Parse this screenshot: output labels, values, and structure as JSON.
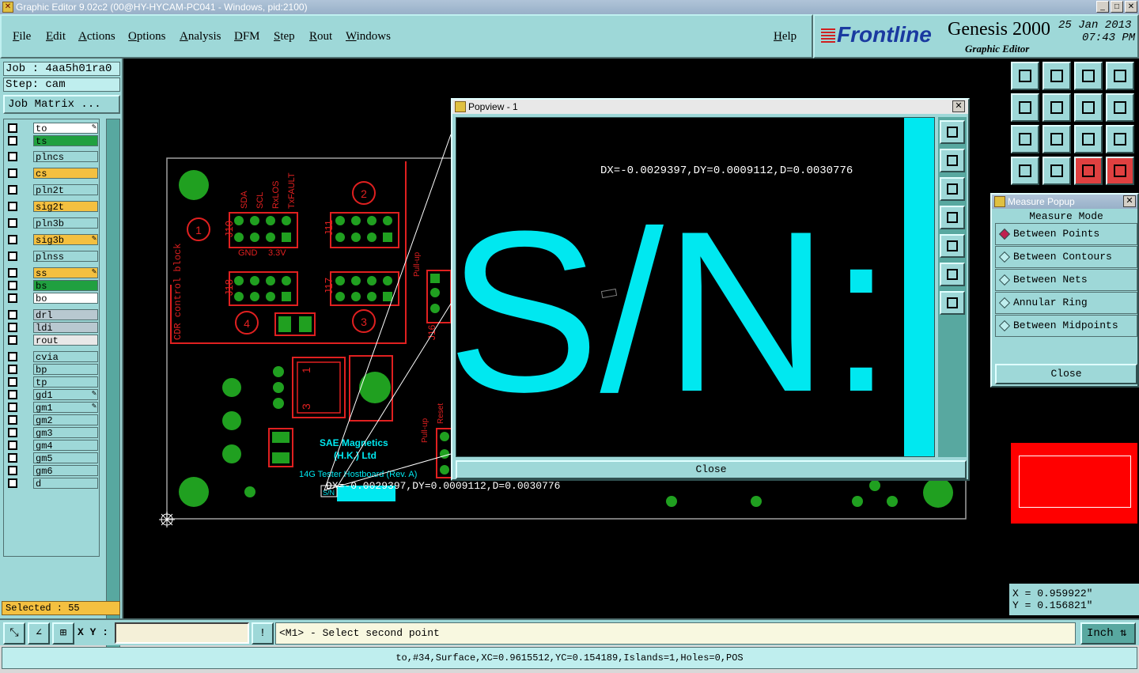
{
  "window": {
    "title": "Graphic Editor 9.02c2 (00@HY-HYCAM-PC041 - Windows, pid:2100)",
    "minimize": "_",
    "maximize": "□",
    "close": "✕"
  },
  "menu": {
    "items": [
      "File",
      "Edit",
      "Actions",
      "Options",
      "Analysis",
      "DFM",
      "Step",
      "Rout",
      "Windows"
    ],
    "help": "Help"
  },
  "brand": {
    "logo": "Frontline",
    "product": "Genesis 2000",
    "subtitle": "Graphic Editor",
    "date": "25 Jan 2013",
    "time": "07:43 PM"
  },
  "job": {
    "job": "Job : 4aa5h01ra0",
    "step": "Step: cam",
    "matrix_button": "Job Matrix ..."
  },
  "layers": [
    {
      "name": "to",
      "color": "#ffffff",
      "flag": "✎"
    },
    {
      "name": "ts",
      "color": "#20a040",
      "flag": ""
    },
    {
      "name": "plncs",
      "color": "#9ed8d8",
      "flag": ""
    },
    {
      "name": "cs",
      "color": "#f4c040",
      "flag": ""
    },
    {
      "name": "pln2t",
      "color": "#9ed8d8",
      "flag": ""
    },
    {
      "name": "sig2t",
      "color": "#f4c040",
      "flag": ""
    },
    {
      "name": "pln3b",
      "color": "#9ed8d8",
      "flag": ""
    },
    {
      "name": "sig3b",
      "color": "#f4c040",
      "flag": "✎"
    },
    {
      "name": "plnss",
      "color": "#9ed8d8",
      "flag": ""
    },
    {
      "name": "ss",
      "color": "#f4c040",
      "flag": "✎"
    },
    {
      "name": "bs",
      "color": "#20a040",
      "flag": ""
    },
    {
      "name": "bo",
      "color": "#ffffff",
      "flag": ""
    },
    {
      "name": "drl",
      "color": "#b8c8d0",
      "flag": ""
    },
    {
      "name": "ldi",
      "color": "#b8c8d0",
      "flag": ""
    },
    {
      "name": "rout",
      "color": "#e8e8e8",
      "flag": ""
    },
    {
      "name": "cvia",
      "color": "#9ed8d8",
      "flag": ""
    },
    {
      "name": "bp",
      "color": "#9ed8d8",
      "flag": ""
    },
    {
      "name": "tp",
      "color": "#9ed8d8",
      "flag": ""
    },
    {
      "name": "gd1",
      "color": "#9ed8d8",
      "flag": "✎"
    },
    {
      "name": "gm1",
      "color": "#9ed8d8",
      "flag": "✎"
    },
    {
      "name": "gm2",
      "color": "#9ed8d8",
      "flag": ""
    },
    {
      "name": "gm3",
      "color": "#9ed8d8",
      "flag": ""
    },
    {
      "name": "gm4",
      "color": "#9ed8d8",
      "flag": ""
    },
    {
      "name": "gm5",
      "color": "#9ed8d8",
      "flag": ""
    },
    {
      "name": "gm6",
      "color": "#9ed8d8",
      "flag": ""
    },
    {
      "name": "d",
      "color": "#9ed8d8",
      "flag": ""
    }
  ],
  "selected": "Selected : 55",
  "board": {
    "connectors": [
      "J10",
      "J11",
      "J18",
      "J17",
      "J16"
    ],
    "pin_labels": [
      "SDA",
      "SCL",
      "RxLOS",
      "TxFAULT"
    ],
    "power_labels": [
      "GND",
      "3.3V"
    ],
    "circle_numbers": [
      "1",
      "2",
      "3",
      "4"
    ],
    "block_label": "CDR control block",
    "pullup_labels": [
      "Pull-up",
      "Pull-up",
      "Reset"
    ],
    "company_line1": "SAE Magnetics",
    "company_line2": "(H.K.) Ltd",
    "board_name": "14G Tester Hostboard (Rev. A)",
    "sn_label": "S/N",
    "measure_readout": "DX=-0.0029397,DY=0.0009112,D=0.0030776",
    "ic_pins": [
      "1",
      "3"
    ]
  },
  "popview": {
    "title": "Popview - 1",
    "readout": "DX=-0.0029397,DY=0.0009112,D=0.0030776",
    "zoom_text": "S/N:",
    "close": "Close"
  },
  "measure": {
    "title": "Measure Popup",
    "mode_header": "Measure Mode",
    "options": [
      "Between Points",
      "Between Contours",
      "Between Nets",
      "Annular Ring",
      "Between Midpoints"
    ],
    "selected_option": "Between Points",
    "close": "Close"
  },
  "coords": {
    "x": "X = 0.959922\"",
    "y": "Y = 0.156821\""
  },
  "command": {
    "xy_label": "X Y :",
    "xy_value": "",
    "prompt": "<M1> - Select second point",
    "unit": "Inch",
    "bang": "!"
  },
  "status": "to,#34,Surface,XC=0.9615512,YC=0.154189,Islands=1,Holes=0,POS",
  "colors": {
    "panel": "#9ed8d8",
    "pcb_red": "#e02020",
    "pcb_green": "#20a020",
    "silkscreen_cyan": "#00e8f0",
    "selected_bg": "#f4c040"
  }
}
